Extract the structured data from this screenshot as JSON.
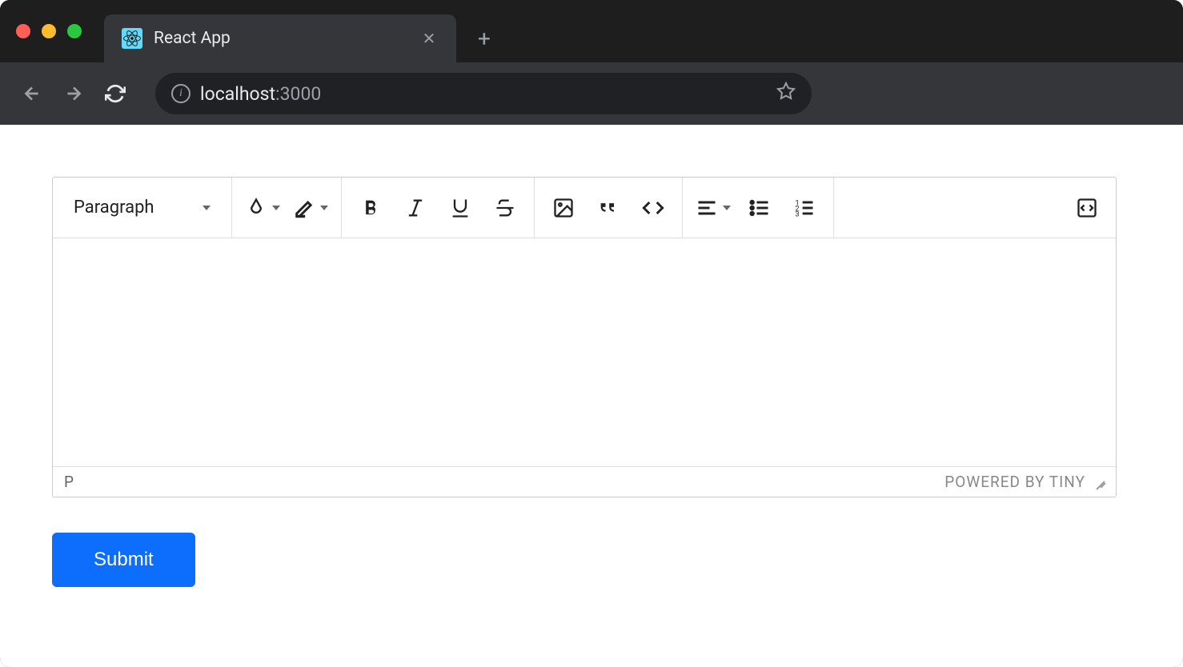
{
  "browser": {
    "tab_title": "React App",
    "url_host": "localhost",
    "url_port": ":3000"
  },
  "editor": {
    "format_label": "Paragraph",
    "status_path": "P",
    "powered_by": "POWERED BY TINY"
  },
  "page": {
    "submit_label": "Submit"
  }
}
